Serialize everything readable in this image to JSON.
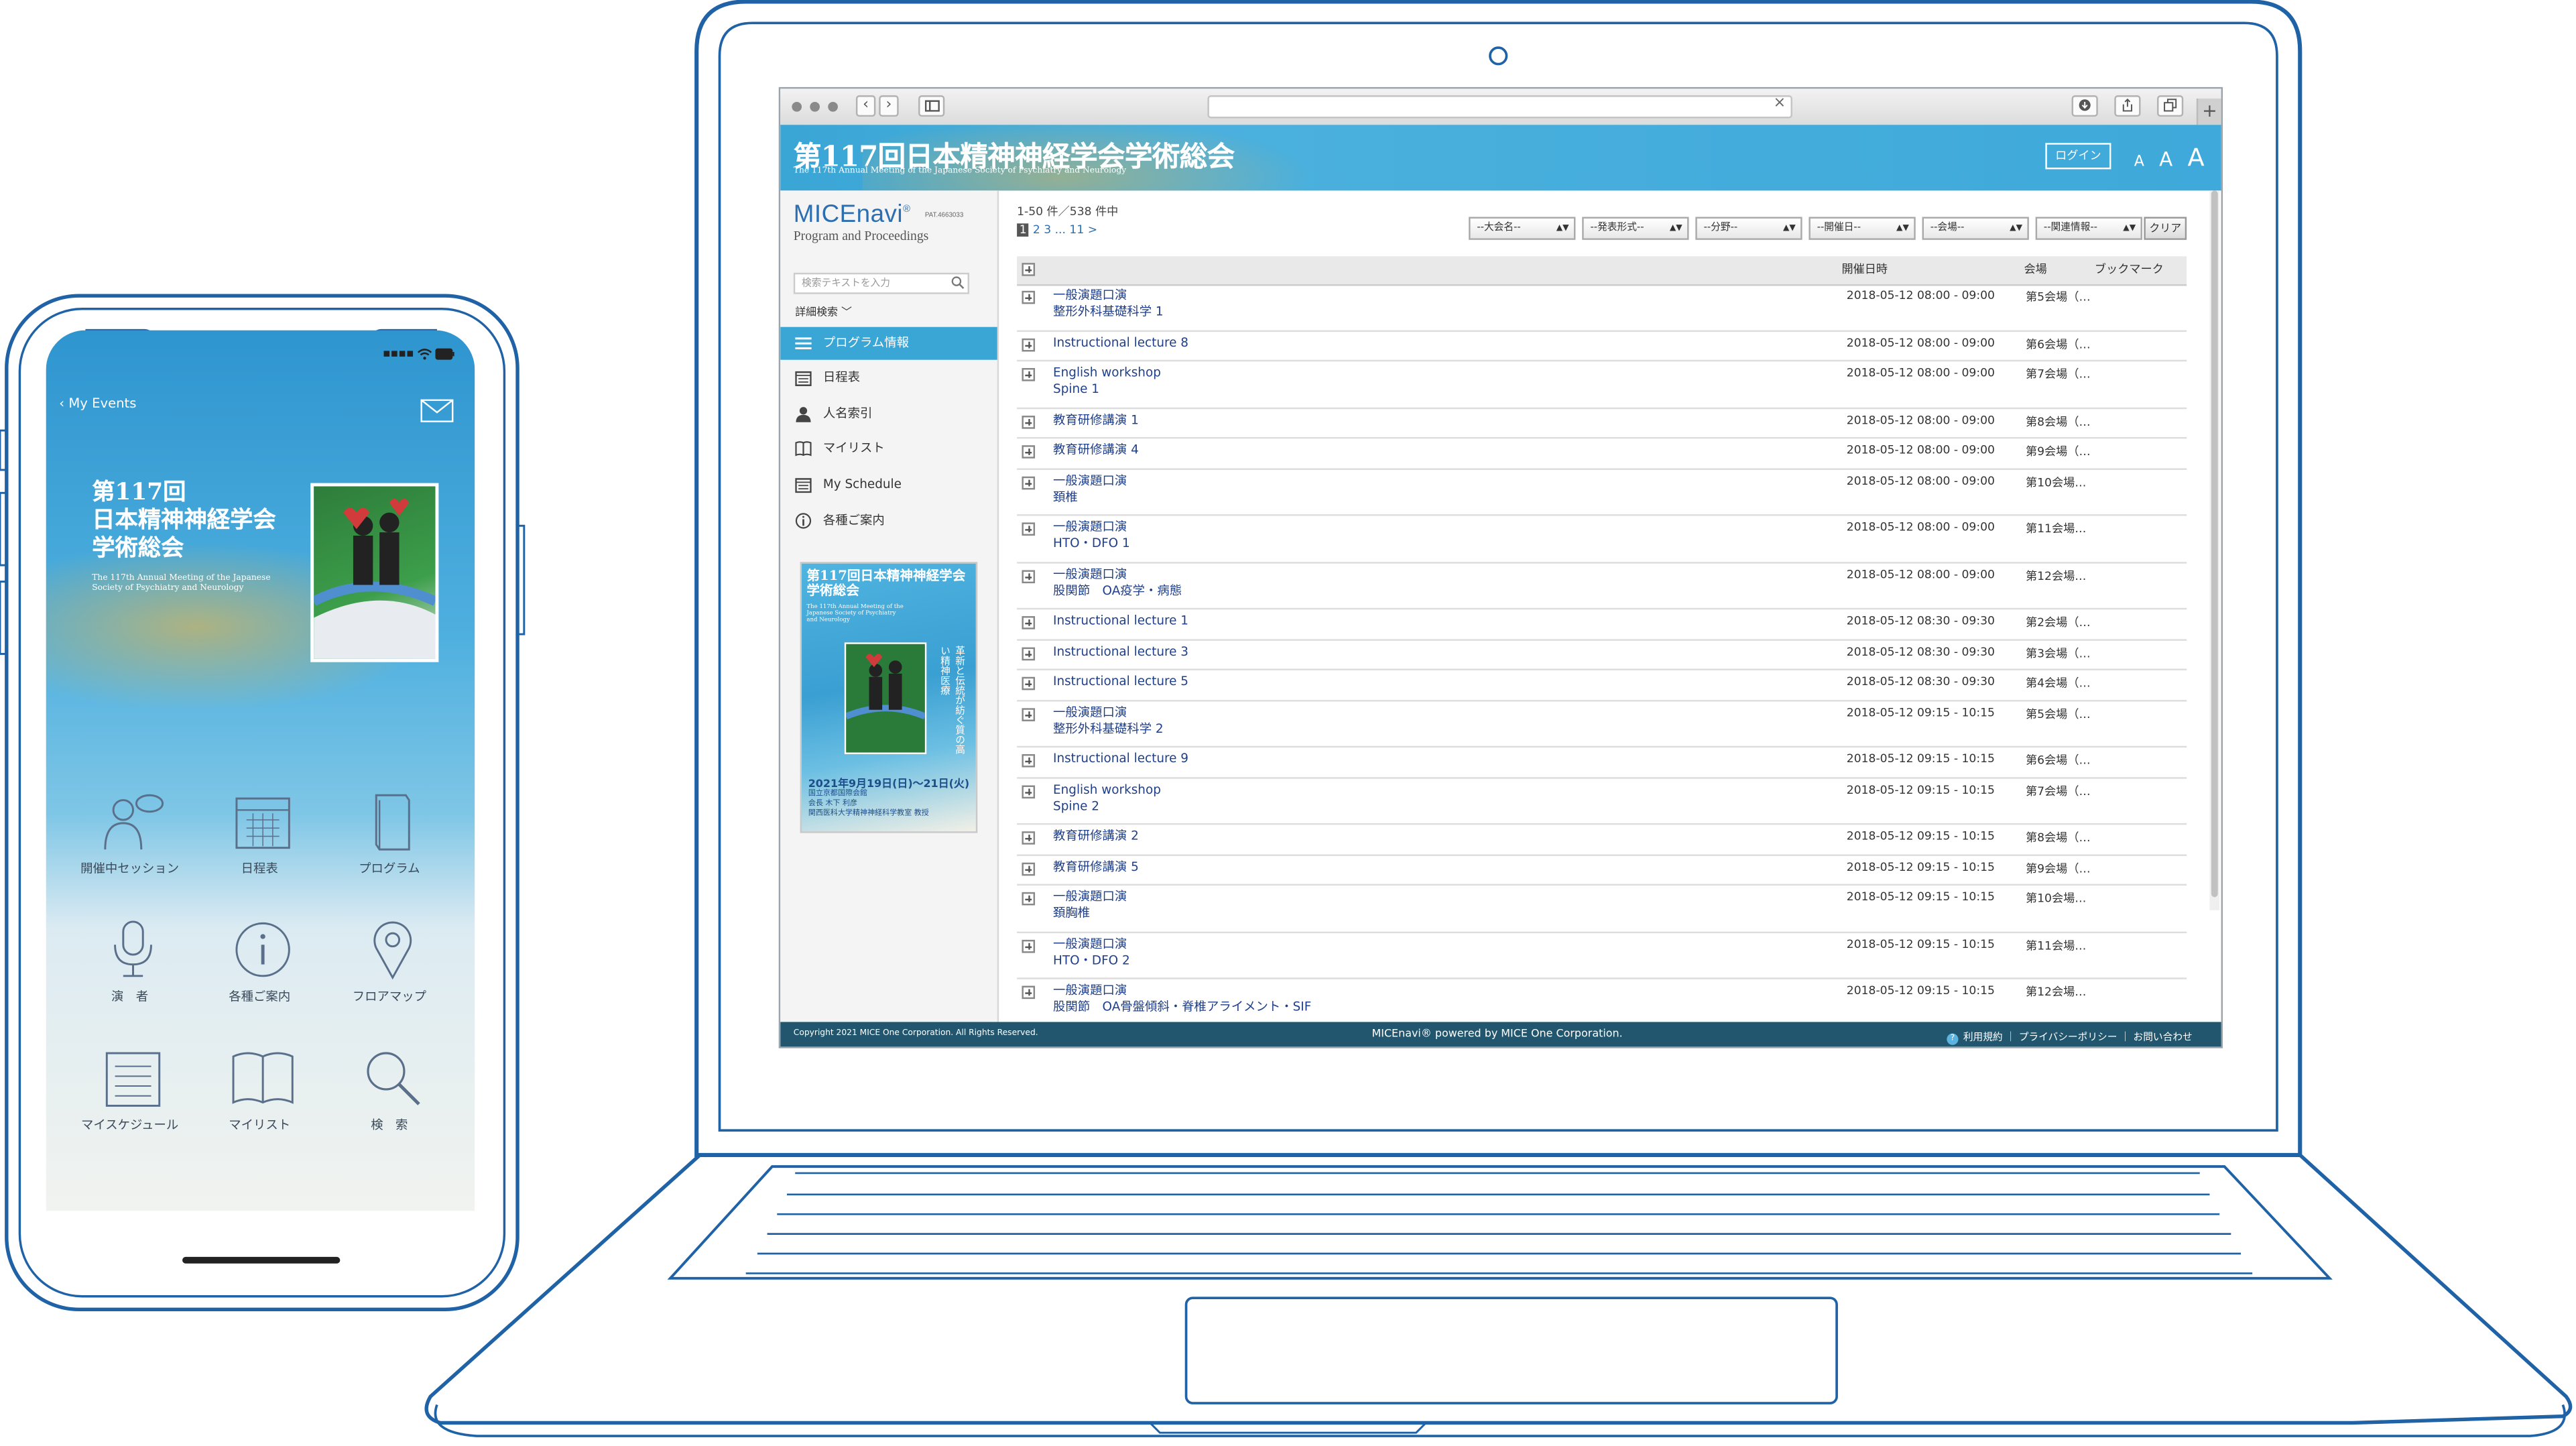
{
  "laptop": {
    "browser": {
      "nav_back": "‹",
      "nav_forward": "›",
      "url_clear": "×",
      "new_tab": "+"
    },
    "banner": {
      "title": "第117回日本精神神経学会学術総会",
      "subtitle": "The 117th Annual Meeting of the Japanese Society of Psychiatry and Neurology",
      "login_label": "ログイン",
      "font_sizes": [
        "A",
        "A",
        "A"
      ]
    },
    "sidebar": {
      "logo": "MICEnavi",
      "logo_mark": "®",
      "patent": "PAT.4663033",
      "logo_sub": "Program and Proceedings",
      "search_placeholder": "検索テキストを入力",
      "advanced_search": "詳細検索 ﹀",
      "nav_items": [
        {
          "label": "プログラム情報",
          "icon": "list-icon"
        },
        {
          "label": "日程表",
          "icon": "calendar-icon"
        },
        {
          "label": "人名索引",
          "icon": "person-icon"
        },
        {
          "label": "マイリスト",
          "icon": "book-icon"
        },
        {
          "label": "My Schedule",
          "icon": "calendar-icon"
        },
        {
          "label": "各種ご案内",
          "icon": "info-icon"
        }
      ],
      "poster": {
        "title": "第117回日本精神神経学会学術総会",
        "subtitle": "The 117th Annual Meeting of the Japanese Society of Psychiatry and Neurology",
        "vertical_text": "革新と伝統が紡ぐ質の高い精神医療",
        "date": "2021年9月19日(日)〜21日(火)",
        "venue_1": "国立京都国際会館",
        "venue_2": "会長 木下 利彦",
        "venue_3": "関西医科大学精神神経科学教室 教授"
      }
    },
    "content": {
      "count": "1-50 件／538 件中",
      "pager": {
        "current": "1",
        "rest": " 2  3 ... 11  >"
      },
      "filters": [
        "--大会名--",
        "--発表形式--",
        "--分野--",
        "--開催日--",
        "--会場--",
        "--関連情報--"
      ],
      "clear_label": "クリア",
      "columns": {
        "datetime": "開催日時",
        "venue": "会場",
        "bookmark": "ブックマーク"
      },
      "rows": [
        {
          "title": [
            "一般演題口演",
            "整形外科基礎科学 1"
          ],
          "datetime": "2018-05-12 08:00 - 09:00",
          "venue": "第5会場（…"
        },
        {
          "title": [
            "Instructional lecture 8"
          ],
          "datetime": "2018-05-12 08:00 - 09:00",
          "venue": "第6会場（…"
        },
        {
          "title": [
            "English workshop",
            "Spine 1"
          ],
          "datetime": "2018-05-12 08:00 - 09:00",
          "venue": "第7会場（…"
        },
        {
          "title": [
            "教育研修講演 1"
          ],
          "datetime": "2018-05-12 08:00 - 09:00",
          "venue": "第8会場（…"
        },
        {
          "title": [
            "教育研修講演 4"
          ],
          "datetime": "2018-05-12 08:00 - 09:00",
          "venue": "第9会場（…"
        },
        {
          "title": [
            "一般演題口演",
            "頚椎"
          ],
          "datetime": "2018-05-12 08:00 - 09:00",
          "venue": "第10会場…"
        },
        {
          "title": [
            "一般演題口演",
            "HTO・DFO 1"
          ],
          "datetime": "2018-05-12 08:00 - 09:00",
          "venue": "第11会場…"
        },
        {
          "title": [
            "一般演題口演",
            "股関節　OA疫学・病態"
          ],
          "datetime": "2018-05-12 08:00 - 09:00",
          "venue": "第12会場…"
        },
        {
          "title": [
            "Instructional lecture 1"
          ],
          "datetime": "2018-05-12 08:30 - 09:30",
          "venue": "第2会場（…"
        },
        {
          "title": [
            "Instructional lecture 3"
          ],
          "datetime": "2018-05-12 08:30 - 09:30",
          "venue": "第3会場（…"
        },
        {
          "title": [
            "Instructional lecture 5"
          ],
          "datetime": "2018-05-12 08:30 - 09:30",
          "venue": "第4会場（…"
        },
        {
          "title": [
            "一般演題口演",
            "整形外科基礎科学 2"
          ],
          "datetime": "2018-05-12 09:15 - 10:15",
          "venue": "第5会場（…"
        },
        {
          "title": [
            "Instructional lecture 9"
          ],
          "datetime": "2018-05-12 09:15 - 10:15",
          "venue": "第6会場（…"
        },
        {
          "title": [
            "English workshop",
            "Spine 2"
          ],
          "datetime": "2018-05-12 09:15 - 10:15",
          "venue": "第7会場（…"
        },
        {
          "title": [
            "教育研修講演 2"
          ],
          "datetime": "2018-05-12 09:15 - 10:15",
          "venue": "第8会場（…"
        },
        {
          "title": [
            "教育研修講演 5"
          ],
          "datetime": "2018-05-12 09:15 - 10:15",
          "venue": "第9会場（…"
        },
        {
          "title": [
            "一般演題口演",
            "頚胸椎"
          ],
          "datetime": "2018-05-12 09:15 - 10:15",
          "venue": "第10会場…"
        },
        {
          "title": [
            "一般演題口演",
            "HTO・DFO 2"
          ],
          "datetime": "2018-05-12 09:15 - 10:15",
          "venue": "第11会場…"
        },
        {
          "title": [
            "一般演題口演",
            "股関節　OA骨盤傾斜・脊椎アライメント・SIF"
          ],
          "datetime": "2018-05-12 09:15 - 10:15",
          "venue": "第12会場…"
        }
      ]
    },
    "footer": {
      "copyright": "Copyright 2021 MICE One Corporation. All Rights Reserved.",
      "powered": "MICEnavi® powered by MICE One Corporation.",
      "help_icon": "?",
      "links": "利用規約 ｜ プライバシーポリシー ｜ お問い合わせ"
    }
  },
  "phone": {
    "back_label": "My Events",
    "title_lines": [
      "第117回",
      "日本精神神経学会",
      "学術総会"
    ],
    "subtitle": "The 117th Annual Meeting of the Japanese Society of Psychiatry and Neurology",
    "tiles": [
      {
        "label": "開催中セッション",
        "icon": "session-icon"
      },
      {
        "label": "日程表",
        "icon": "calendar-icon"
      },
      {
        "label": "プログラム",
        "icon": "book-icon"
      },
      {
        "label": "演　者",
        "icon": "microphone-icon"
      },
      {
        "label": "各種ご案内",
        "icon": "info-icon"
      },
      {
        "label": "フロアマップ",
        "icon": "map-pin-icon"
      },
      {
        "label": "マイスケジュール",
        "icon": "schedule-icon"
      },
      {
        "label": "マイリスト",
        "icon": "open-book-icon"
      },
      {
        "label": "検　索",
        "icon": "search-icon"
      }
    ]
  },
  "colors": {
    "outline": "#1f62a6",
    "accent": "#3aa6d6",
    "footer": "#21566e",
    "link": "#1f3f8a"
  }
}
